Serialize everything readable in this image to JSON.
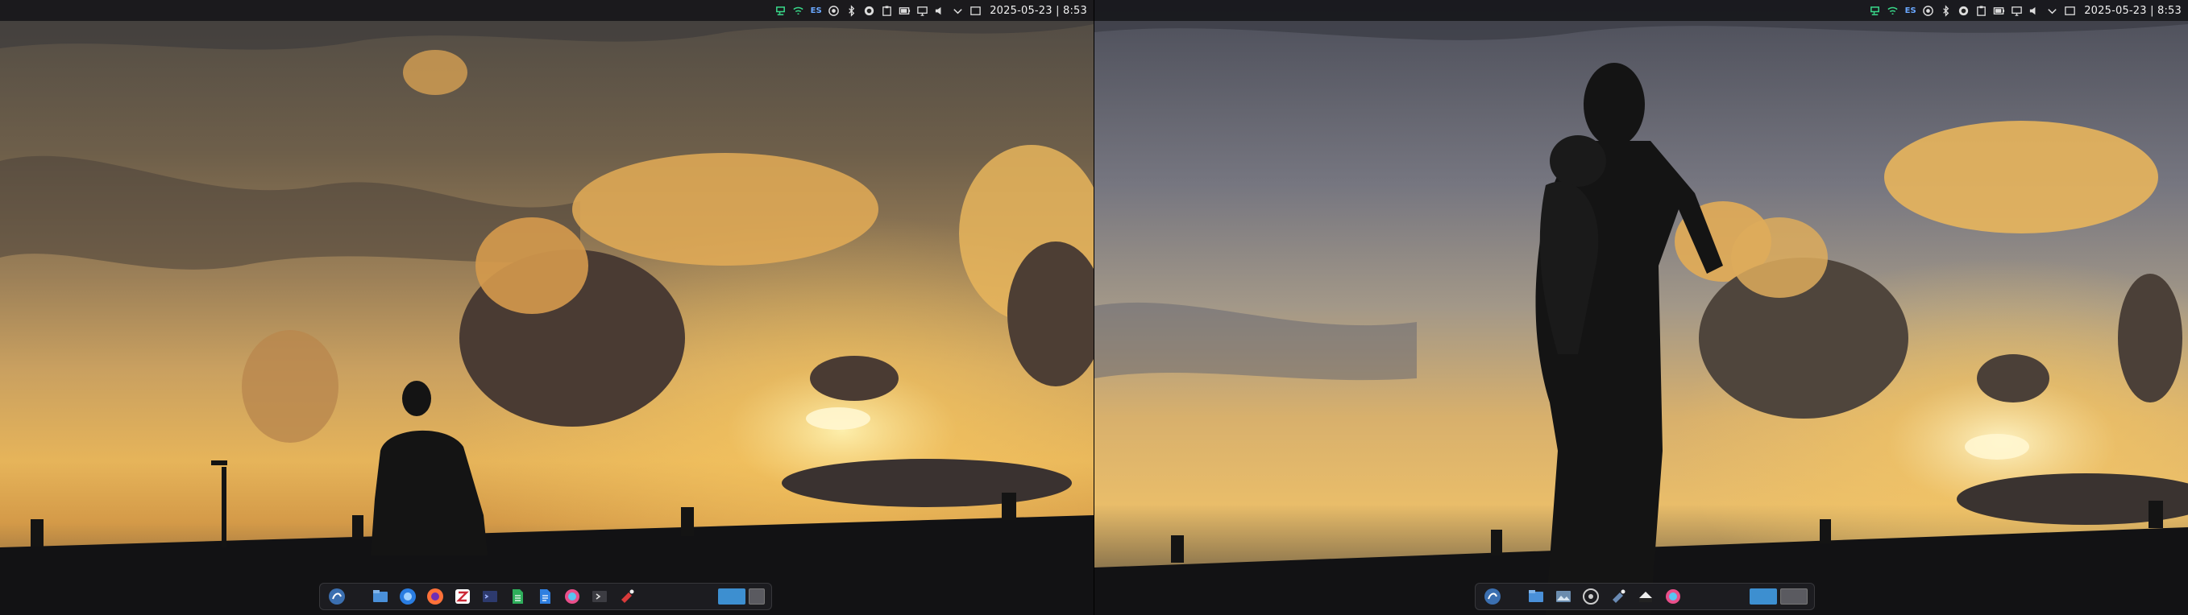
{
  "screens": [
    {
      "name": "left",
      "clock": "2025-05-23 | 8:53",
      "tray_keyboard_layout": "ES"
    },
    {
      "name": "right",
      "clock": "2025-05-23 | 8:53",
      "tray_keyboard_layout": "ES"
    }
  ],
  "tray_icons": [
    "network-wired-icon",
    "network-wireless-icon",
    "keyboard-layout-indicator",
    "media-record-icon",
    "bluetooth-icon",
    "color-picker-icon",
    "clipboard-icon",
    "battery-icon",
    "display-icon",
    "volume-icon",
    "chevron-down-icon",
    "notifications-icon"
  ],
  "dock_left_apps": [
    "app-launcher-icon",
    "file-manager-icon",
    "browser-icon",
    "firefox-icon",
    "zotero-icon",
    "terminal-icon",
    "spreadsheet-icon",
    "document-icon",
    "color-icon",
    "console-icon",
    "cleaner-icon"
  ],
  "dock_right_apps": [
    "app-launcher-icon",
    "file-manager-icon",
    "image-viewer-icon",
    "settings-icon",
    "cleaner-icon",
    "theme-icon",
    "color-icon"
  ],
  "colors": {
    "panel": "#121216",
    "accent": "#3d8fd0",
    "sky_top": "#5b5448",
    "sky_glow": "#f2b54a"
  }
}
